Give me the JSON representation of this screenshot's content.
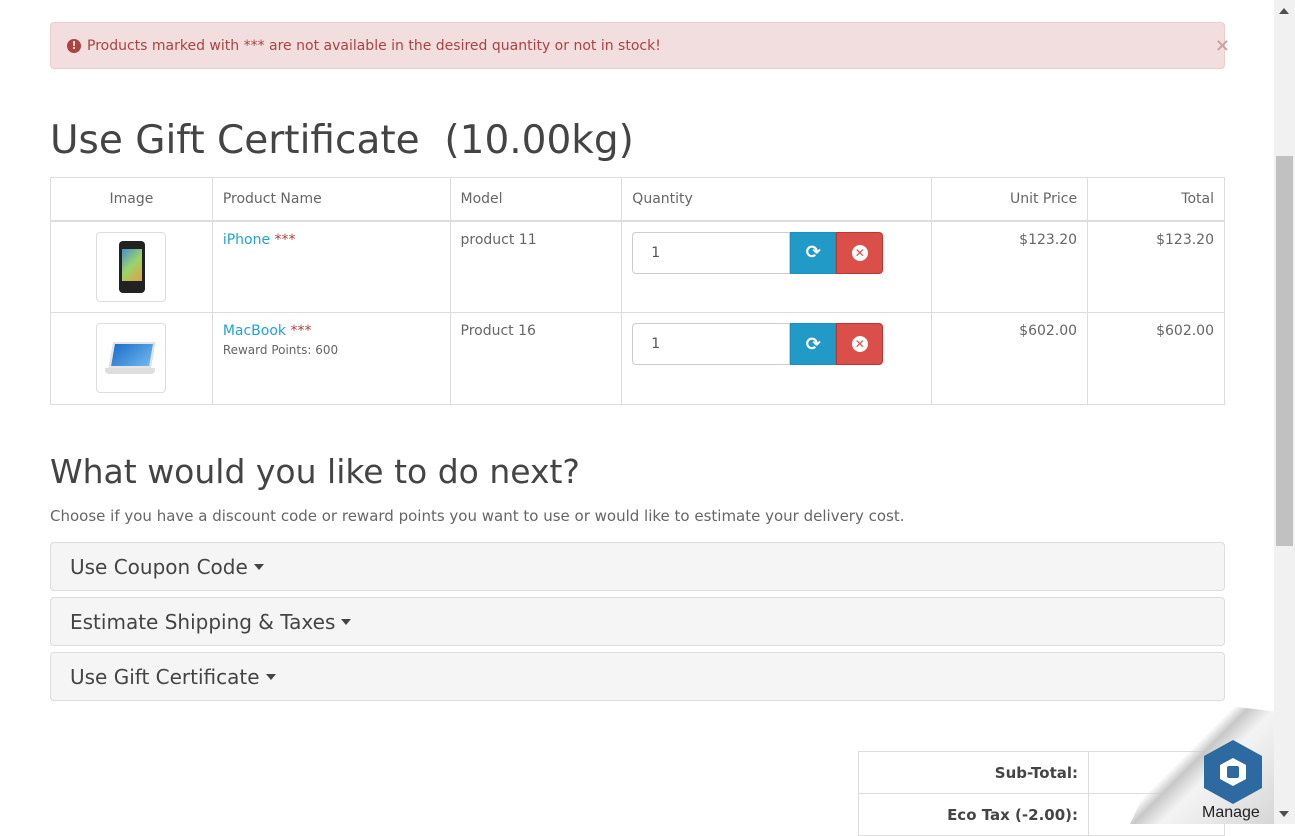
{
  "alert": {
    "icon": "exclamation-circle-icon",
    "text": "Products marked with *** are not available in the desired quantity or not in stock!",
    "close": "×"
  },
  "page": {
    "title": "Use Gift Certificate  (10.00kg)"
  },
  "cart": {
    "headers": {
      "image": "Image",
      "name": "Product Name",
      "model": "Model",
      "quantity": "Quantity",
      "unit_price": "Unit Price",
      "total": "Total"
    },
    "rows": [
      {
        "name": "iPhone",
        "stock_mark": "***",
        "reward": "",
        "model": "product 11",
        "quantity": "1",
        "unit_price": "$123.20",
        "total": "$123.20"
      },
      {
        "name": "MacBook",
        "stock_mark": "***",
        "reward": "Reward Points: 600",
        "model": "Product 16",
        "quantity": "1",
        "unit_price": "$602.00",
        "total": "$602.00"
      }
    ],
    "update_icon": "refresh-icon",
    "remove_icon": "times-circle-icon"
  },
  "next": {
    "title": "What would you like to do next?",
    "description": "Choose if you have a discount code or reward points you want to use or would like to estimate your delivery cost.",
    "panels": [
      "Use Coupon Code",
      "Estimate Shipping & Taxes",
      "Use Gift Certificate"
    ]
  },
  "totals": [
    {
      "label": "Sub-Total:",
      "value": "$"
    },
    {
      "label": "Eco Tax (-2.00):",
      "value": ""
    }
  ],
  "widget": {
    "label": "Manage"
  },
  "colors": {
    "link": "#23a1d1",
    "alert_bg": "#f2dede",
    "alert_text": "#a94442",
    "update_btn": "#229ac8",
    "remove_btn": "#da4f49"
  }
}
